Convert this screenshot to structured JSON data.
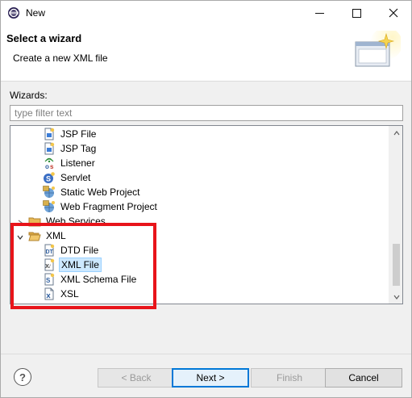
{
  "window": {
    "title": "New",
    "icons": {
      "app": "eclipse-icon",
      "minimize": "minimize-icon",
      "maximize": "maximize-icon",
      "close": "close-icon"
    }
  },
  "header": {
    "title": "Select a wizard",
    "description": "Create a new XML file",
    "graphic": "wizard-banner-icon"
  },
  "wizards": {
    "label": "Wizards:",
    "filter_placeholder": "type filter text",
    "filter_value": ""
  },
  "tree": {
    "items": [
      {
        "label": "JSP File",
        "icon": "jsp-file-icon",
        "level": 2,
        "selected": false
      },
      {
        "label": "JSP Tag",
        "icon": "jsp-tag-icon",
        "level": 2,
        "selected": false
      },
      {
        "label": "Listener",
        "icon": "listener-icon",
        "level": 2,
        "selected": false
      },
      {
        "label": "Servlet",
        "icon": "servlet-icon",
        "level": 2,
        "selected": false
      },
      {
        "label": "Static Web Project",
        "icon": "static-web-project-icon",
        "level": 2,
        "selected": false
      },
      {
        "label": "Web Fragment Project",
        "icon": "web-fragment-project-icon",
        "level": 2,
        "selected": false
      },
      {
        "label": "Web Services",
        "icon": "folder-icon",
        "level": 1,
        "expanded": false,
        "selected": false
      },
      {
        "label": "XML",
        "icon": "folder-open-icon",
        "level": 1,
        "expanded": true,
        "selected": false
      },
      {
        "label": "DTD File",
        "icon": "dtd-file-icon",
        "level": 2,
        "selected": false
      },
      {
        "label": "XML File",
        "icon": "xml-file-icon",
        "level": 2,
        "selected": true
      },
      {
        "label": "XML Schema File",
        "icon": "xml-schema-file-icon",
        "level": 2,
        "selected": false
      },
      {
        "label": "XSL",
        "icon": "xsl-file-icon",
        "level": 2,
        "selected": false
      }
    ],
    "scroll_position": 0.85
  },
  "buttons": {
    "help_icon": "help-icon",
    "back": "< Back",
    "next": "Next >",
    "finish": "Finish",
    "cancel": "Cancel"
  },
  "colors": {
    "selection": "#cce8ff",
    "default_button_border": "#0078d7",
    "annotation_box": "#e8141a"
  }
}
